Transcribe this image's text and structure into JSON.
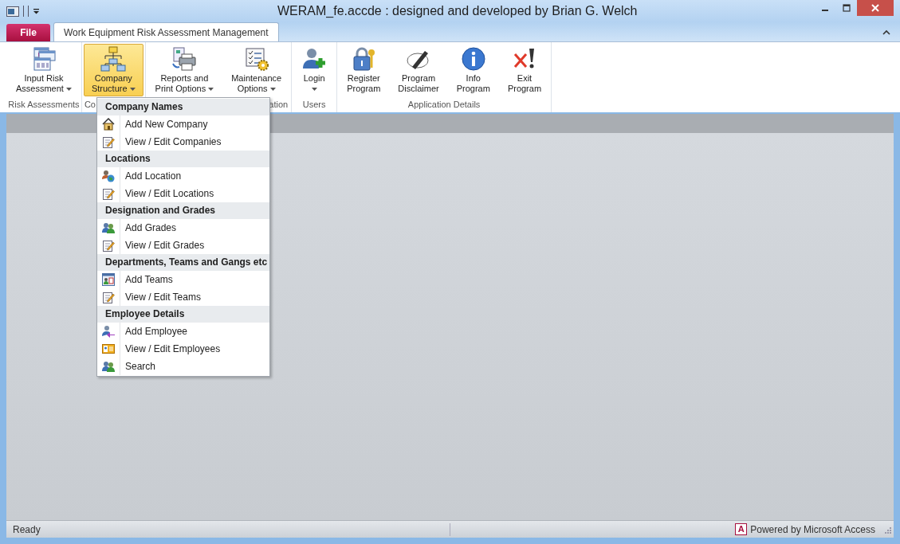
{
  "window": {
    "title": "WERAM_fe.accde : designed and developed by Brian G. Welch"
  },
  "tabs": [
    {
      "label": "File",
      "kind": "file",
      "selected": false
    },
    {
      "label": "Work Equipment Risk Assessment Management",
      "kind": "tab",
      "selected": true
    }
  ],
  "ribbon": {
    "groups": [
      {
        "label": "Risk Assessments",
        "buttons": [
          {
            "lines": [
              "Input Risk",
              "Assessment"
            ],
            "kind": "form",
            "dropdown": true,
            "selected": false
          }
        ]
      },
      {
        "label": "Co",
        "buttons": [
          {
            "lines": [
              "Company",
              "Structure"
            ],
            "kind": "org",
            "dropdown": true,
            "selected": true
          }
        ]
      },
      {
        "label": "ation",
        "buttons": [
          {
            "lines": [
              "Reports and",
              "Print Options"
            ],
            "kind": "printer",
            "dropdown": true,
            "selected": false
          },
          {
            "lines": [
              "Maintenance",
              "Options"
            ],
            "kind": "checklist",
            "dropdown": true,
            "selected": false
          }
        ]
      },
      {
        "label": "Users",
        "buttons": [
          {
            "lines": [
              "Login"
            ],
            "kind": "useradd",
            "dropdown": true,
            "selected": false
          }
        ]
      },
      {
        "label": "Application Details",
        "buttons": [
          {
            "lines": [
              "Register",
              "Program"
            ],
            "kind": "lock",
            "dropdown": false,
            "selected": false
          },
          {
            "lines": [
              "Program",
              "Disclaimer"
            ],
            "kind": "pen",
            "dropdown": false,
            "selected": false
          },
          {
            "lines": [
              "Info",
              "Program"
            ],
            "kind": "info",
            "dropdown": false,
            "selected": false
          },
          {
            "lines": [
              "Exit",
              "Program"
            ],
            "kind": "exit",
            "dropdown": false,
            "selected": false
          }
        ]
      }
    ]
  },
  "menu": {
    "sections": [
      {
        "header": "Company Names",
        "items": [
          {
            "label": "Add New Company",
            "kind": "house"
          },
          {
            "label": "View / Edit Companies",
            "kind": "edit"
          }
        ]
      },
      {
        "header": "Locations",
        "items": [
          {
            "label": "Add Location",
            "kind": "globe"
          },
          {
            "label": "View / Edit Locations",
            "kind": "edit"
          }
        ]
      },
      {
        "header": "Designation and Grades",
        "items": [
          {
            "label": "Add Grades",
            "kind": "people"
          },
          {
            "label": "View / Edit Grades",
            "kind": "edit"
          }
        ]
      },
      {
        "header": "Departments, Teams and Gangs etc",
        "items": [
          {
            "label": "Add Teams",
            "kind": "teams"
          },
          {
            "label": "View / Edit Teams",
            "kind": "edit"
          }
        ]
      },
      {
        "header": "Employee Details",
        "items": [
          {
            "label": "Add Employee",
            "kind": "employee"
          },
          {
            "label": "View / Edit Employees",
            "kind": "card"
          },
          {
            "label": "Search",
            "kind": "people"
          }
        ]
      }
    ]
  },
  "status_bar": {
    "text": "Ready",
    "logo_letter": "A",
    "powered_by": "Powered by Microsoft Access"
  }
}
